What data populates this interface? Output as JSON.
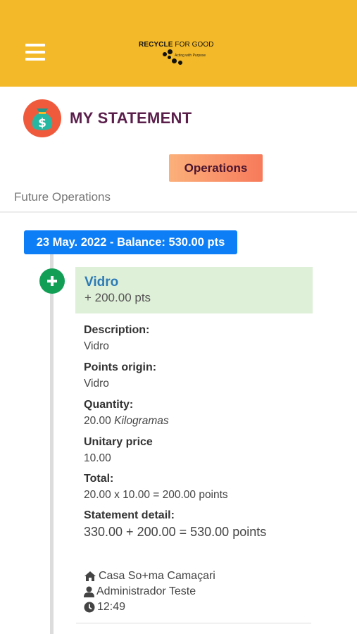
{
  "header": {
    "menu_icon": "hamburger-menu-icon",
    "logo": {
      "brand_bold": "RECYCLE",
      "brand_rest": " FOR GOOD",
      "tagline": "Acting with Purpose"
    },
    "background": "#f3b928"
  },
  "page": {
    "title": "MY STATEMENT",
    "title_icon": "money-bag-icon"
  },
  "tabs": {
    "operations": "Operations",
    "future": "Future Operations"
  },
  "statement": {
    "date_balance": "23 May. 2022 - Balance: 530.00 pts",
    "entry": {
      "icon": "plus-circle-icon",
      "name": "Vidro",
      "points": "+ 200.00 pts",
      "details": {
        "description_label": "Description:",
        "description_value": "Vidro",
        "origin_label": "Points origin:",
        "origin_value": "Vidro",
        "quantity_label": "Quantity:",
        "quantity_number": "20.00",
        "quantity_unit": "Kilogramas",
        "unit_price_label": "Unitary price",
        "unit_price_value": "10.00",
        "total_label": "Total:",
        "total_value": "20.00 x 10.00 = 200.00 points",
        "statement_detail_label": "Statement detail:",
        "statement_detail_value": "330.00 + 200.00 = 530.00 points"
      },
      "meta": {
        "location": "Casa So+ma Camaçari",
        "user": "Administrador Teste",
        "time": "12:49"
      }
    }
  },
  "colors": {
    "accent_yellow": "#f3b928",
    "title_purple": "#5a1e4b",
    "badge_blue": "#0d7ef6",
    "plus_green": "#129f55",
    "card_green": "#dff0d8",
    "entry_blue": "#2d7bb6"
  }
}
